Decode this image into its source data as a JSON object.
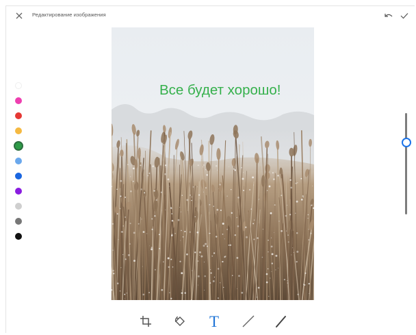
{
  "header": {
    "title": "Редактирование изображения",
    "close_icon": "close-icon",
    "undo_icon": "undo-icon",
    "done_icon": "check-icon"
  },
  "palette": {
    "colors": [
      "#ffffff",
      "#ee3fb0",
      "#e53935",
      "#f5b942",
      "#2e9b47",
      "#6aa8ec",
      "#1a66e0",
      "#8a1ce0",
      "#cfcfcf",
      "#777777",
      "#111111"
    ],
    "selected_color": "#2e9b47"
  },
  "canvas": {
    "overlay_text": "Все будет хорошо!",
    "overlay_text_color": "#35b04c"
  },
  "size_slider": {
    "value": 0.29
  },
  "tools": [
    {
      "icon": "crop-icon"
    },
    {
      "icon": "rotate-icon"
    },
    {
      "icon": "text-icon",
      "label": "T",
      "active": true
    },
    {
      "icon": "line-icon"
    },
    {
      "icon": "brush-icon"
    }
  ],
  "accent_color": "#1f74d6"
}
